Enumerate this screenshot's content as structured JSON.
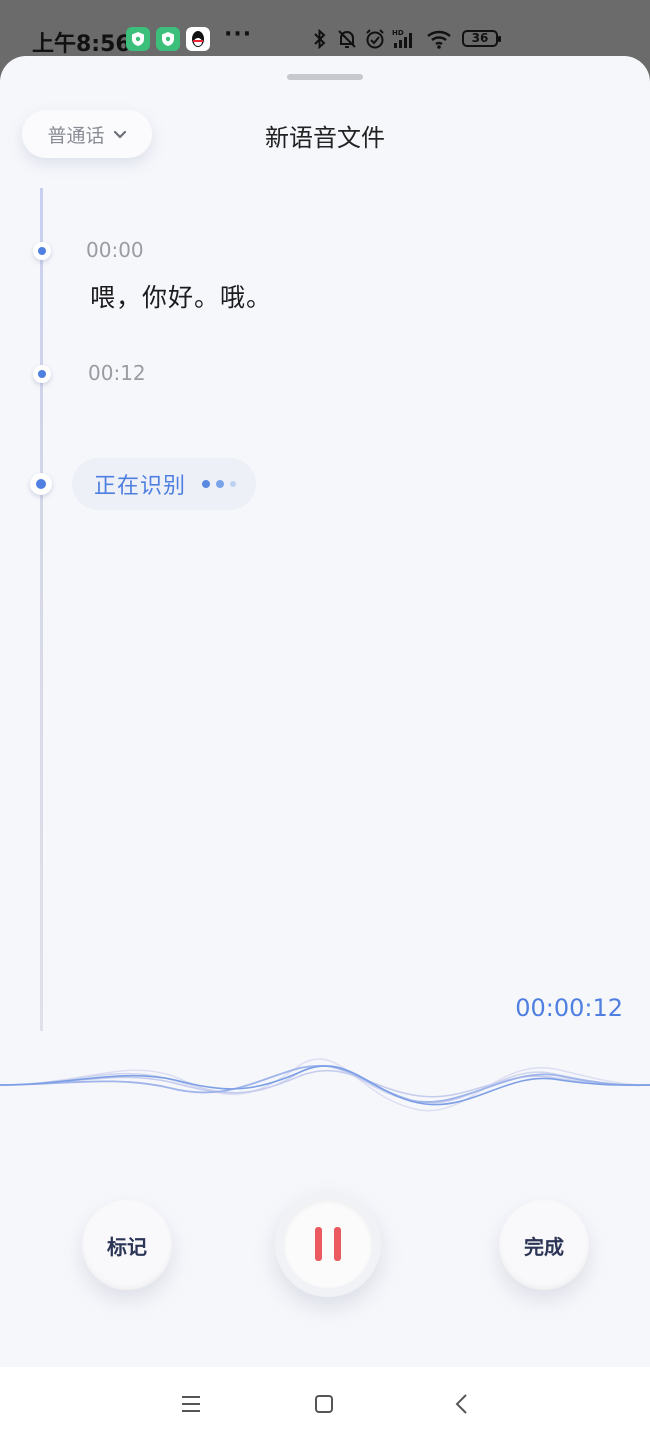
{
  "status_bar": {
    "time": "上午8:56",
    "more": "···",
    "battery": "36"
  },
  "header": {
    "language_label": "普通话",
    "title": "新语音文件"
  },
  "transcript": {
    "segments": [
      {
        "timestamp": "00:00",
        "text": "喂，你好。哦。"
      },
      {
        "timestamp": "00:12",
        "text": ""
      }
    ],
    "recognizing_label": "正在识别"
  },
  "recording": {
    "duration": "00:00:12"
  },
  "controls": {
    "mark_label": "标记",
    "done_label": "完成"
  },
  "colors": {
    "accent": "#4f7fe0",
    "pause": "#ea5a5f",
    "sheet_bg": "#f6f7fb"
  },
  "icons": [
    "shield-app-icon",
    "qq-icon",
    "bluetooth-icon",
    "mute-bell-icon",
    "alarm-icon",
    "signal-icon",
    "wifi-icon",
    "battery-icon",
    "chevron-down-icon",
    "menu-icon",
    "home-square-icon",
    "back-icon"
  ]
}
